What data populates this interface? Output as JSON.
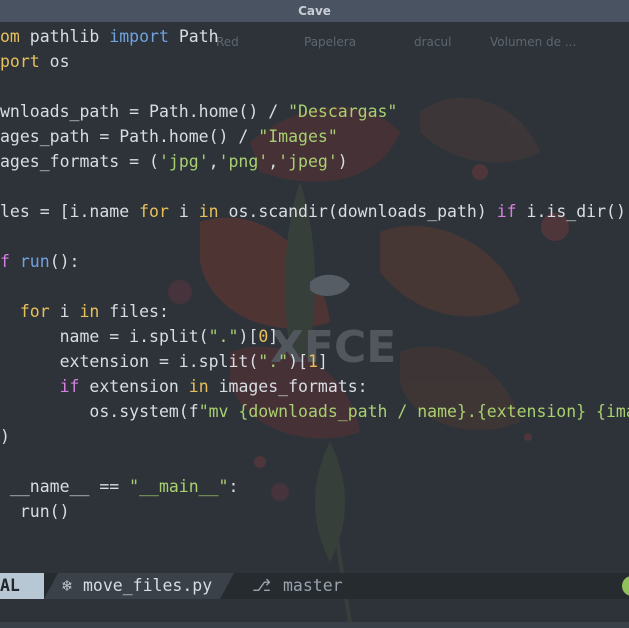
{
  "window": {
    "title": "Cave"
  },
  "desktop_labels": [
    "Red",
    "Papelera",
    "dracul",
    "Volumen de ..."
  ],
  "editor": {
    "mode": "AL",
    "file_icon": "python-icon",
    "filename": "move_files.py",
    "branch_icon": "git-branch-icon",
    "branch": "master"
  },
  "colors": {
    "keyword": "#e8c05a",
    "import": "#6fa3e0",
    "string": "#a8d070",
    "accent_purple": "#d67fe0",
    "status_ok": "#8fc05a"
  }
}
